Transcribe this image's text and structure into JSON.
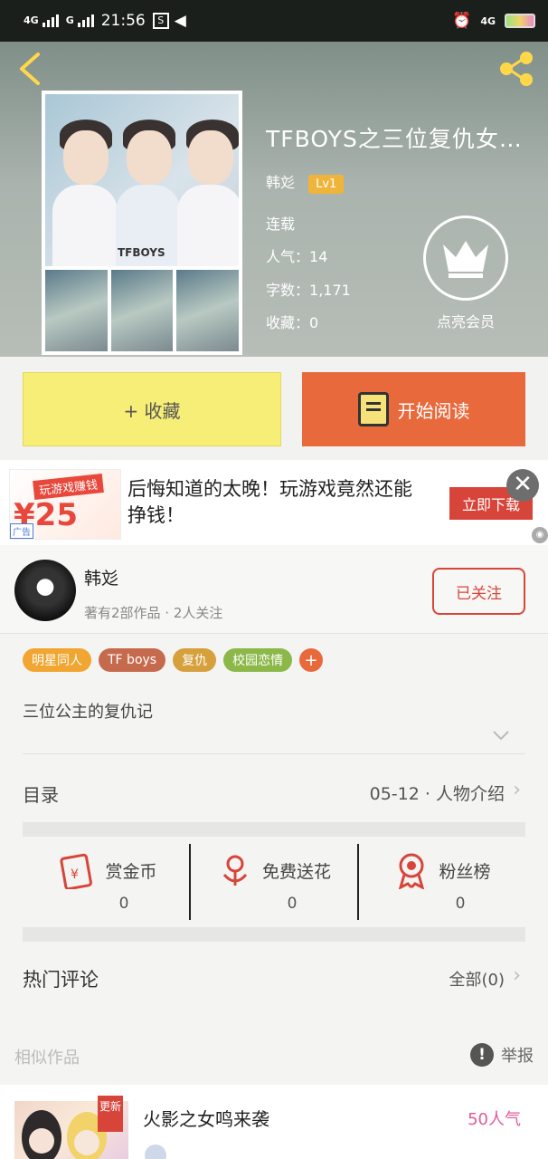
{
  "status_bar": {
    "network1": "4G",
    "network2": "G",
    "time": "21:56",
    "right_network": "4G"
  },
  "header": {
    "back_icon": "chevron-left-icon",
    "share_icon": "share-icon"
  },
  "book": {
    "title": "TFBOYS之三位复仇女…",
    "author": "韩彣",
    "level": "Lv1",
    "status": "连载",
    "popularity_label": "人气",
    "popularity_value": "：14",
    "words_label": "字数",
    "words_value": "：1,171",
    "favorites_label": "收藏",
    "favorites_value": "：0",
    "cover_logo": "TFBOYS"
  },
  "vip": {
    "label": "点亮会员",
    "icon": "crown-icon"
  },
  "actions": {
    "collect_label": "+ 收藏",
    "read_label": "开始阅读",
    "collect_color": "#f6ee76",
    "read_color": "#e8693c"
  },
  "ad": {
    "thumb_title": "玩游戏赚钱",
    "thumb_number": "¥25",
    "thumb_tag": "广告",
    "text": "后悔知道的太晚！玩游戏竟然还能挣钱！",
    "button": "立即下载"
  },
  "author": {
    "name": "韩彣",
    "stats": "著有2部作品 · 2人关注",
    "follow_label": "已关注"
  },
  "tags": [
    {
      "label": "明星同人",
      "color": "#f0a630"
    },
    {
      "label": "TF boys",
      "color": "#c66a4e"
    },
    {
      "label": "复仇",
      "color": "#d6a03c"
    },
    {
      "label": "校园恋情",
      "color": "#8cb84a"
    }
  ],
  "tag_add": "+",
  "intro": "三位公主的复仇记",
  "toc": {
    "label": "目录",
    "date": "05-12",
    "separator": "·",
    "extra": "人物介绍"
  },
  "stats": [
    {
      "label": "赏金币",
      "value": "0",
      "icon": "red-packet-icon"
    },
    {
      "label": "免费送花",
      "value": "0",
      "icon": "flower-icon"
    },
    {
      "label": "粉丝榜",
      "value": "0",
      "icon": "medal-icon"
    }
  ],
  "comments": {
    "label": "热门评论",
    "all": "全部(0)"
  },
  "similar": {
    "label": "相似作品",
    "report": "举报"
  },
  "recommend": {
    "badge": "更新",
    "title": "火影之女鸣来袭",
    "popularity": "50人气"
  }
}
